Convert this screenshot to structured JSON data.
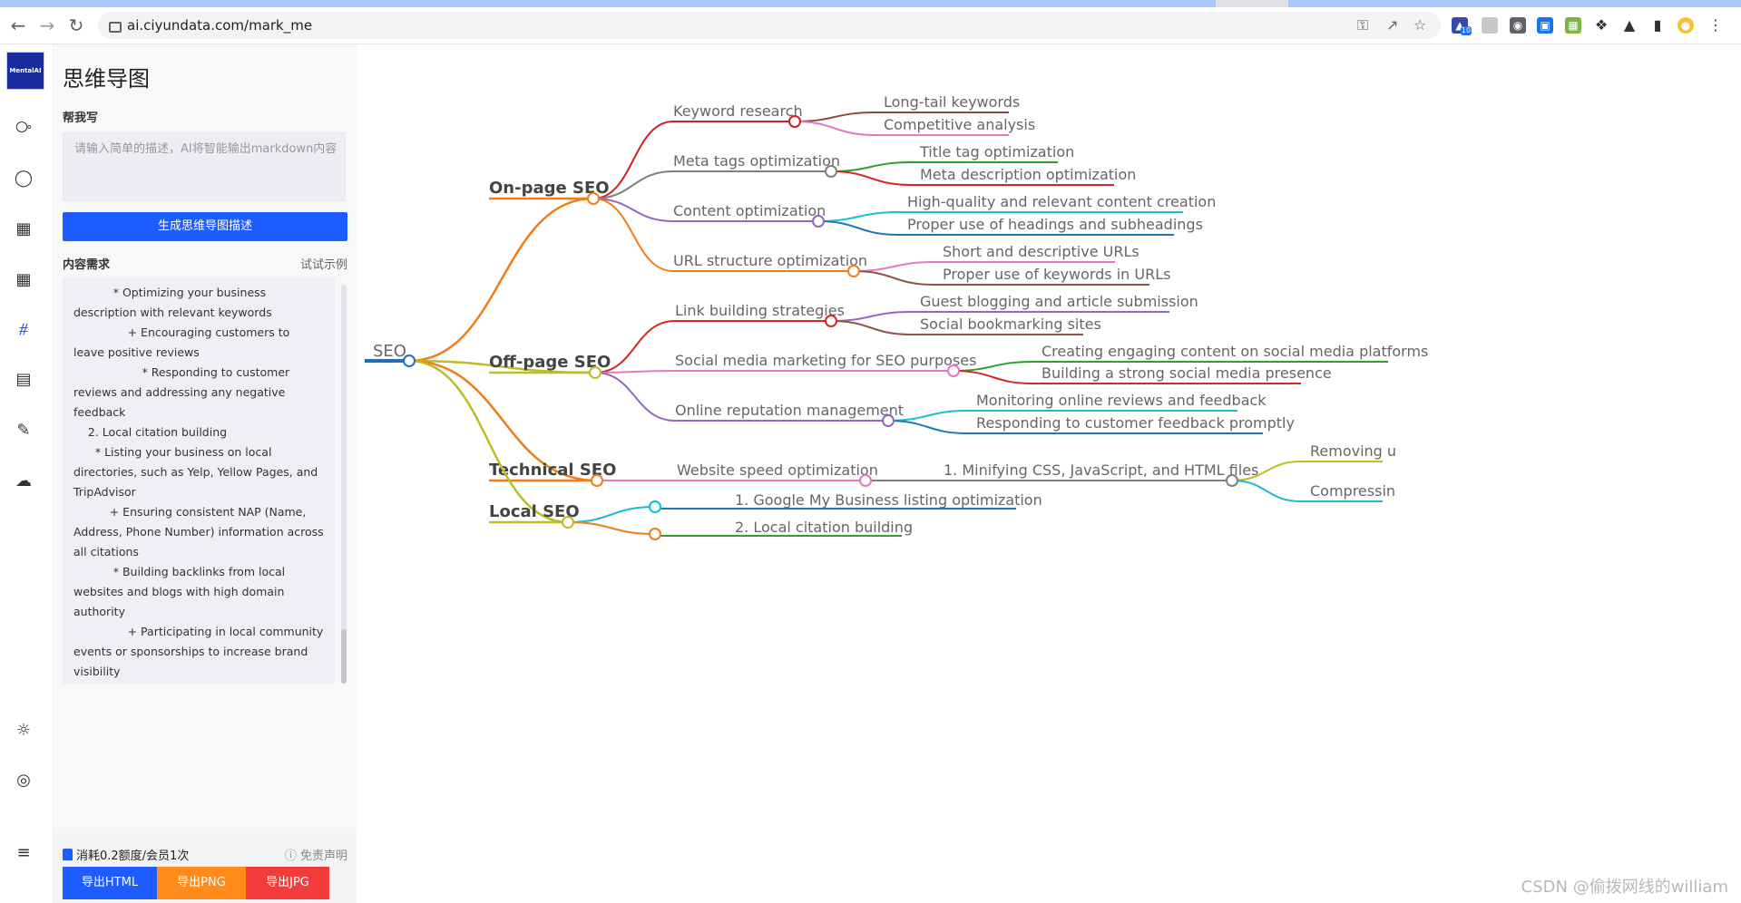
{
  "browser": {
    "url": "ai.ciyundata.com/mark_me",
    "ext_badge": "10"
  },
  "rail": {
    "logo_text": "MentalAI"
  },
  "panel": {
    "title": "思维导图",
    "help_label": "帮我写",
    "prompt_placeholder": "请输入简单的描述，AI将智能输出markdown内容",
    "generate_label": "生成思维导图描述",
    "content_label": "内容需求",
    "try_example": "试试示例",
    "content_text": "           * Optimizing your business description with relevant keywords\n               + Encouraging customers to leave positive reviews\n                   * Responding to customer reviews and addressing any negative feedback\n    2. Local citation building\n      * Listing your business on local directories, such as Yelp, Yellow Pages, and TripAdvisor\n          + Ensuring consistent NAP (Name, Address, Phone Number) information across all citations\n           * Building backlinks from local websites and blogs with high domain authority\n               + Participating in local community events or sponsorships to increase brand visibility",
    "cost_text": "消耗0.2额度/会员1次",
    "disclaimer": "免责声明",
    "export_html": "导出HTML",
    "export_png": "导出PNG",
    "export_jpg": "导出JPG"
  },
  "mindmap": {
    "root": "SEO",
    "branches": [
      {
        "label": "On-page SEO",
        "color": "#f07d17",
        "children": [
          {
            "label": "Keyword research",
            "color": "#d11f26",
            "children": [
              {
                "label": "Long-tail keywords",
                "color": "#8b4a3c"
              },
              {
                "label": "Competitive analysis",
                "color": "#e377c2"
              }
            ]
          },
          {
            "label": "Meta tags optimization",
            "color": "#7f7f7f",
            "children": [
              {
                "label": "Title tag optimization",
                "color": "#2ca02c"
              },
              {
                "label": "Meta description optimization",
                "color": "#d62728"
              }
            ]
          },
          {
            "label": "Content optimization",
            "color": "#9467bd",
            "children": [
              {
                "label": "High-quality and relevant content creation",
                "color": "#17becf"
              },
              {
                "label": "Proper use of headings and subheadings",
                "color": "#1f77b4"
              }
            ]
          },
          {
            "label": "URL structure optimization",
            "color": "#f07d17",
            "children": [
              {
                "label": "Short and descriptive URLs",
                "color": "#e377c2"
              },
              {
                "label": "Proper use of keywords in URLs",
                "color": "#8c564b"
              }
            ]
          }
        ]
      },
      {
        "label": "Off-page SEO",
        "color": "#bcbd22",
        "children": [
          {
            "label": "Link building strategies",
            "color": "#d62728",
            "children": [
              {
                "label": "Guest blogging and article submission",
                "color": "#9467bd"
              },
              {
                "label": "Social bookmarking sites",
                "color": "#8c564b"
              }
            ]
          },
          {
            "label": "Social media marketing for SEO purposes",
            "color": "#e377c2",
            "children": [
              {
                "label": "Creating engaging content on social media platforms",
                "color": "#2ca02c"
              },
              {
                "label": "Building a strong social media presence",
                "color": "#d62728"
              }
            ]
          },
          {
            "label": "Online reputation management",
            "color": "#9467bd",
            "children": [
              {
                "label": "Monitoring online reviews and feedback",
                "color": "#17becf"
              },
              {
                "label": "Responding to customer feedback promptly",
                "color": "#1f77b4"
              }
            ]
          }
        ]
      },
      {
        "label": "Technical SEO",
        "color": "#f07d17",
        "children": [
          {
            "label": "Website speed optimization",
            "color": "#e377c2",
            "children": [
              {
                "label": "1. Minifying CSS, JavaScript, and HTML files",
                "color": "#7f7f7f",
                "children": [
                  {
                    "label": "Removing u",
                    "color": "#bcbd22"
                  },
                  {
                    "label": "Compressin",
                    "color": "#17becf"
                  }
                ]
              }
            ]
          }
        ]
      },
      {
        "label": "Local SEO",
        "color": "#bcbd22",
        "children": [
          {
            "label": "1. Google My Business listing optimization",
            "color": "#17becf",
            "line_color": "#1f77b4"
          },
          {
            "label": "2. Local citation building",
            "color": "#f07d17",
            "line_color": "#2ca02c"
          }
        ]
      }
    ]
  },
  "watermark": "CSDN @偷拨网线的william"
}
